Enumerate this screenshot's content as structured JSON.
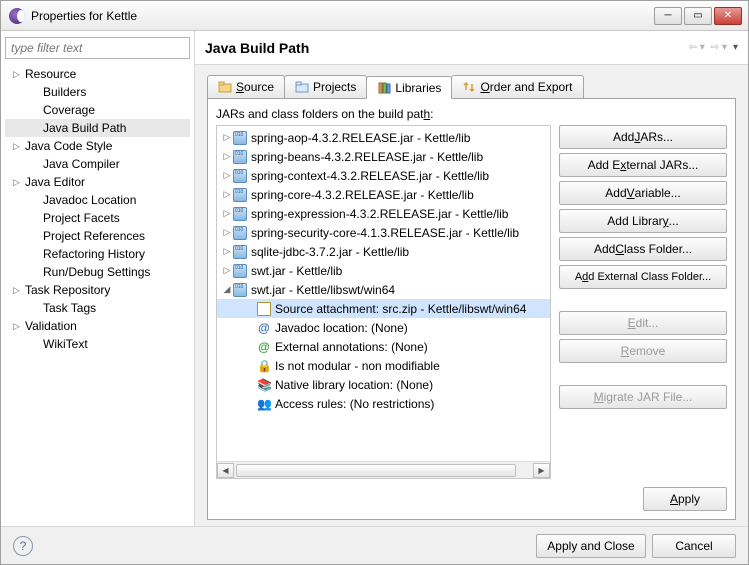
{
  "window": {
    "title": "Properties for Kettle"
  },
  "filter_placeholder": "type filter text",
  "nav": [
    {
      "label": "Resource",
      "level": 1,
      "expandable": true
    },
    {
      "label": "Builders",
      "level": 2
    },
    {
      "label": "Coverage",
      "level": 2
    },
    {
      "label": "Java Build Path",
      "level": 2,
      "selected": true
    },
    {
      "label": "Java Code Style",
      "level": 1,
      "expandable": true
    },
    {
      "label": "Java Compiler",
      "level": 2
    },
    {
      "label": "Java Editor",
      "level": 1,
      "expandable": true
    },
    {
      "label": "Javadoc Location",
      "level": 2
    },
    {
      "label": "Project Facets",
      "level": 2
    },
    {
      "label": "Project References",
      "level": 2
    },
    {
      "label": "Refactoring History",
      "level": 2
    },
    {
      "label": "Run/Debug Settings",
      "level": 2
    },
    {
      "label": "Task Repository",
      "level": 1,
      "expandable": true
    },
    {
      "label": "Task Tags",
      "level": 2
    },
    {
      "label": "Validation",
      "level": 1,
      "expandable": true
    },
    {
      "label": "WikiText",
      "level": 2
    }
  ],
  "page_title": "Java Build Path",
  "tabs": {
    "source": "Source",
    "projects": "Projects",
    "libraries": "Libraries",
    "order": "Order and Export"
  },
  "jars_caption": "JARs and class folders on the build path:",
  "jars": [
    {
      "label": "spring-aop-4.3.2.RELEASE.jar - Kettle/lib",
      "state": "collapsed"
    },
    {
      "label": "spring-beans-4.3.2.RELEASE.jar - Kettle/lib",
      "state": "collapsed"
    },
    {
      "label": "spring-context-4.3.2.RELEASE.jar - Kettle/lib",
      "state": "collapsed"
    },
    {
      "label": "spring-core-4.3.2.RELEASE.jar - Kettle/lib",
      "state": "collapsed"
    },
    {
      "label": "spring-expression-4.3.2.RELEASE.jar - Kettle/lib",
      "state": "collapsed"
    },
    {
      "label": "spring-security-core-4.1.3.RELEASE.jar - Kettle/lib",
      "state": "collapsed"
    },
    {
      "label": "sqlite-jdbc-3.7.2.jar - Kettle/lib",
      "state": "collapsed"
    },
    {
      "label": "swt.jar - Kettle/lib",
      "state": "collapsed"
    },
    {
      "label": "swt.jar - Kettle/libswt/win64",
      "state": "expanded",
      "children": [
        {
          "kind": "source",
          "label": "Source attachment: src.zip - Kettle/libswt/win64",
          "selected": true
        },
        {
          "kind": "javadoc",
          "label": "Javadoc location: (None)"
        },
        {
          "kind": "extann",
          "label": "External annotations: (None)"
        },
        {
          "kind": "modular",
          "label": "Is not modular - non modifiable"
        },
        {
          "kind": "native",
          "label": "Native library location: (None)"
        },
        {
          "kind": "access",
          "label": "Access rules: (No restrictions)"
        }
      ]
    }
  ],
  "buttons": {
    "add_jars": "Add JARs...",
    "add_ext_jars": "Add External JARs...",
    "add_variable": "Add Variable...",
    "add_library": "Add Library...",
    "add_class_folder": "Add Class Folder...",
    "add_ext_class_folder": "Add External Class Folder...",
    "edit": "Edit...",
    "remove": "Remove",
    "migrate": "Migrate JAR File..."
  },
  "footer": {
    "apply": "Apply",
    "apply_close": "Apply and Close",
    "cancel": "Cancel"
  }
}
